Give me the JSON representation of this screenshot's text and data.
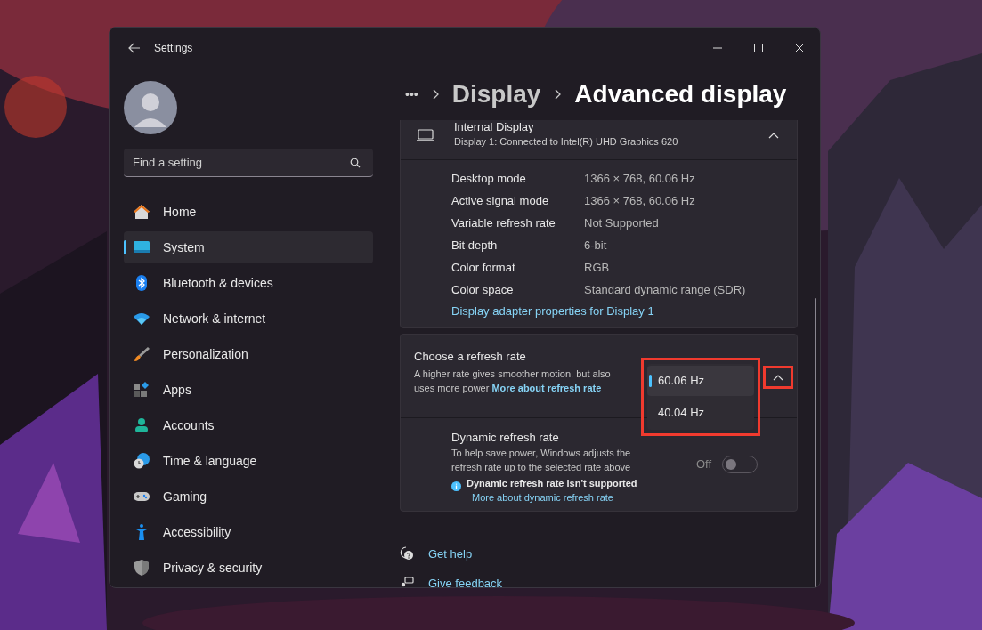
{
  "window": {
    "title": "Settings"
  },
  "search": {
    "placeholder": "Find a setting"
  },
  "sidebar": {
    "items": [
      {
        "label": "Home",
        "selected": false
      },
      {
        "label": "System",
        "selected": true
      },
      {
        "label": "Bluetooth & devices",
        "selected": false
      },
      {
        "label": "Network & internet",
        "selected": false
      },
      {
        "label": "Personalization",
        "selected": false
      },
      {
        "label": "Apps",
        "selected": false
      },
      {
        "label": "Accounts",
        "selected": false
      },
      {
        "label": "Time & language",
        "selected": false
      },
      {
        "label": "Gaming",
        "selected": false
      },
      {
        "label": "Accessibility",
        "selected": false
      },
      {
        "label": "Privacy & security",
        "selected": false
      }
    ]
  },
  "breadcrumb": {
    "overflow": "•••",
    "items": [
      "Display",
      "Advanced display"
    ]
  },
  "display_card": {
    "title": "Internal Display",
    "subtitle": "Display 1: Connected to Intel(R) UHD Graphics 620",
    "expanded": true,
    "rows": [
      {
        "label": "Desktop mode",
        "value": "1366 × 768, 60.06 Hz"
      },
      {
        "label": "Active signal mode",
        "value": "1366 × 768, 60.06 Hz"
      },
      {
        "label": "Variable refresh rate",
        "value": "Not Supported"
      },
      {
        "label": "Bit depth",
        "value": "6-bit"
      },
      {
        "label": "Color format",
        "value": "RGB"
      },
      {
        "label": "Color space",
        "value": "Standard dynamic range (SDR)"
      }
    ],
    "link": "Display adapter properties for Display 1"
  },
  "refresh_card": {
    "title": "Choose a refresh rate",
    "description": "A higher rate gives smoother motion, but also uses more power",
    "link": "More about refresh rate",
    "highlighted": true,
    "options": [
      {
        "label": "60.06 Hz",
        "selected": true
      },
      {
        "label": "40.04 Hz",
        "selected": false
      }
    ],
    "dynamic": {
      "title": "Dynamic refresh rate",
      "description": "To help save power, Windows adjusts the refresh rate up to the selected rate above",
      "notice": "Dynamic refresh rate isn't supported",
      "link": "More about dynamic refresh rate",
      "state_label": "Off",
      "on": false
    }
  },
  "footer_links": [
    {
      "label": "Get help"
    },
    {
      "label": "Give feedback"
    }
  ]
}
